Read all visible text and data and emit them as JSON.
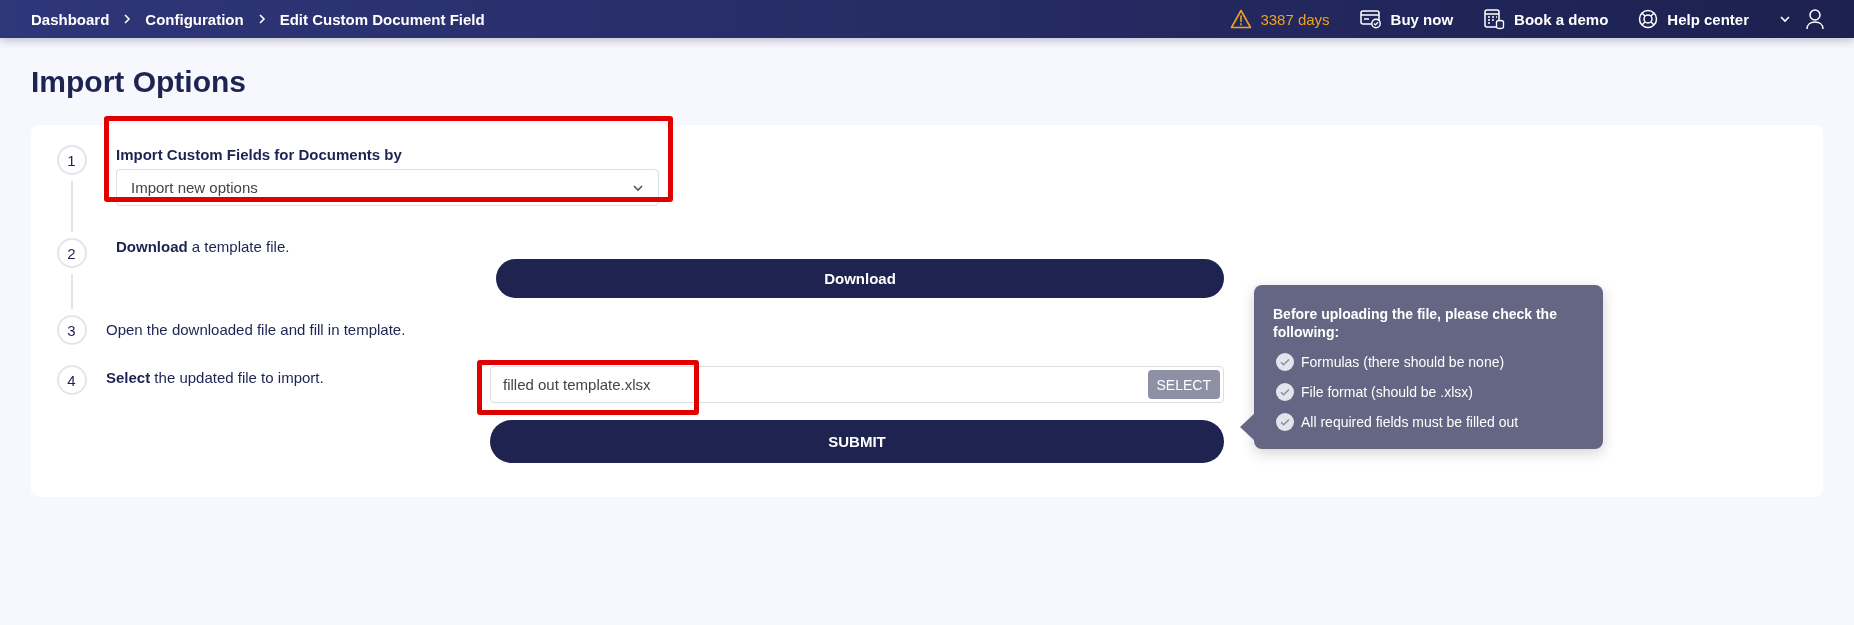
{
  "breadcrumbs": [
    "Dashboard",
    "Configuration",
    "Edit Custom Document Field"
  ],
  "topbar": {
    "trial": "3387 days",
    "actions": [
      {
        "kind": "buy",
        "label": "Buy now"
      },
      {
        "kind": "demo",
        "label": "Book a demo"
      },
      {
        "kind": "help",
        "label": "Help center"
      }
    ]
  },
  "title": "Import Options",
  "steps": [
    {
      "number": "1",
      "kind": "select",
      "label": "Import Custom Fields for Documents by",
      "value": "Import new options",
      "highlighted": true
    },
    {
      "number": "2",
      "kind": "download",
      "text": "**Download** a template file.",
      "button": "Download"
    },
    {
      "number": "3",
      "kind": "text",
      "text": "Open the downloaded file and fill in template."
    },
    {
      "number": "4",
      "kind": "file",
      "text": "**Select** the updated file to import.",
      "value": "filled out template.xlsx",
      "select_button": "SELECT",
      "submit_button": "SUBMIT",
      "highlighted": true
    }
  ],
  "tooltip": {
    "heading": "Before uploading the file, please check the following:",
    "items": [
      "Formulas (there should be none)",
      "File format (should be .xlsx)",
      "All required fields must be filled out"
    ]
  }
}
